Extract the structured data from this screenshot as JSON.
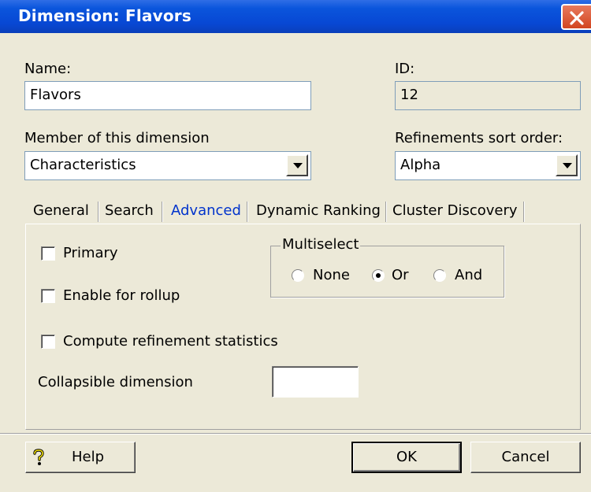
{
  "window": {
    "title": "Dimension:  Flavors"
  },
  "name_field": {
    "label": "Name:",
    "value": "Flavors"
  },
  "id_field": {
    "label": "ID:",
    "value": "12"
  },
  "member_dim": {
    "label": "Member of this dimension",
    "value": "Characteristics"
  },
  "sort_order": {
    "label": "Refinements sort order:",
    "value": "Alpha"
  },
  "tabs": [
    "General",
    "Search",
    "Advanced",
    "Dynamic Ranking",
    "Cluster Discovery"
  ],
  "active_tab": "Advanced",
  "advanced": {
    "primary": {
      "label": "Primary",
      "checked": false
    },
    "rollup": {
      "label": "Enable for rollup",
      "checked": false
    },
    "refinement_stats": {
      "label": "Compute refinement statistics",
      "checked": false
    },
    "collapsible": {
      "label": "Collapsible dimension",
      "value": ""
    },
    "multiselect": {
      "label": "Multiselect",
      "options": [
        "None",
        "Or",
        "And"
      ],
      "selected": "Or"
    }
  },
  "buttons": {
    "help": "Help",
    "ok": "OK",
    "cancel": "Cancel"
  },
  "icons": {
    "close": "close-icon",
    "help": "help-question-icon",
    "dropdown": "chevron-down-icon"
  },
  "colors": {
    "titlebar": "#0a55dc",
    "dialog_bg": "#ece9d8",
    "active_tab_text": "#0033cc",
    "close_button": "#d2451f"
  }
}
